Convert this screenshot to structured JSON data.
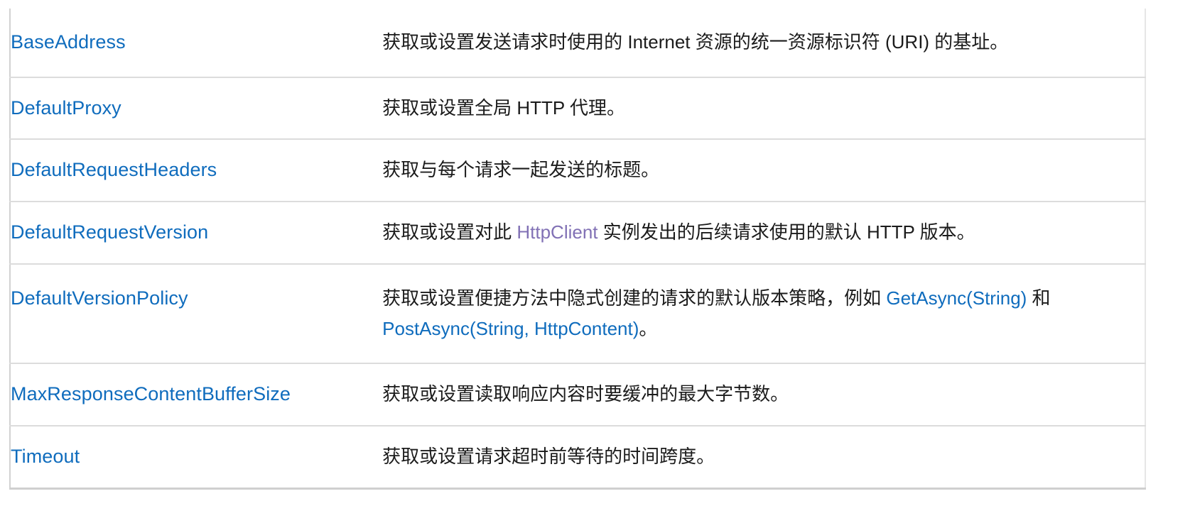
{
  "table": {
    "name": "httpclient-properties-table",
    "rows": [
      {
        "property": "BaseAddress",
        "description_parts": [
          {
            "type": "text",
            "text": "获取或设置发送请求时使用的 Internet 资源的统一资源标识符 (URI) 的基址。"
          }
        ]
      },
      {
        "property": "DefaultProxy",
        "description_parts": [
          {
            "type": "text",
            "text": "获取或设置全局 HTTP 代理。"
          }
        ]
      },
      {
        "property": "DefaultRequestHeaders",
        "description_parts": [
          {
            "type": "text",
            "text": "获取与每个请求一起发送的标题。"
          }
        ]
      },
      {
        "property": "DefaultRequestVersion",
        "description_parts": [
          {
            "type": "text",
            "text": "获取或设置对此 "
          },
          {
            "type": "link",
            "text": "HttpClient",
            "state": "visited"
          },
          {
            "type": "text",
            "text": " 实例发出的后续请求使用的默认 HTTP 版本。"
          }
        ]
      },
      {
        "property": "DefaultVersionPolicy",
        "description_parts": [
          {
            "type": "text",
            "text": "获取或设置便捷方法中隐式创建的请求的默认版本策略，例如 "
          },
          {
            "type": "link",
            "text": "GetAsync(String)",
            "state": "default"
          },
          {
            "type": "text",
            "text": " 和 "
          },
          {
            "type": "link",
            "text": "PostAsync(String, HttpContent)",
            "state": "default"
          },
          {
            "type": "text",
            "text": "。"
          }
        ]
      },
      {
        "property": "MaxResponseContentBufferSize",
        "description_parts": [
          {
            "type": "text",
            "text": "获取或设置读取响应内容时要缓冲的最大字节数。"
          }
        ]
      },
      {
        "property": "Timeout",
        "description_parts": [
          {
            "type": "text",
            "text": "获取或设置请求超时前等待的时间跨度。"
          }
        ]
      }
    ]
  },
  "colors": {
    "link": "#0f6cbd",
    "link_visited": "#8171b5",
    "text": "#1b1b1b",
    "border": "#dcdcdc",
    "background": "#ffffff"
  }
}
